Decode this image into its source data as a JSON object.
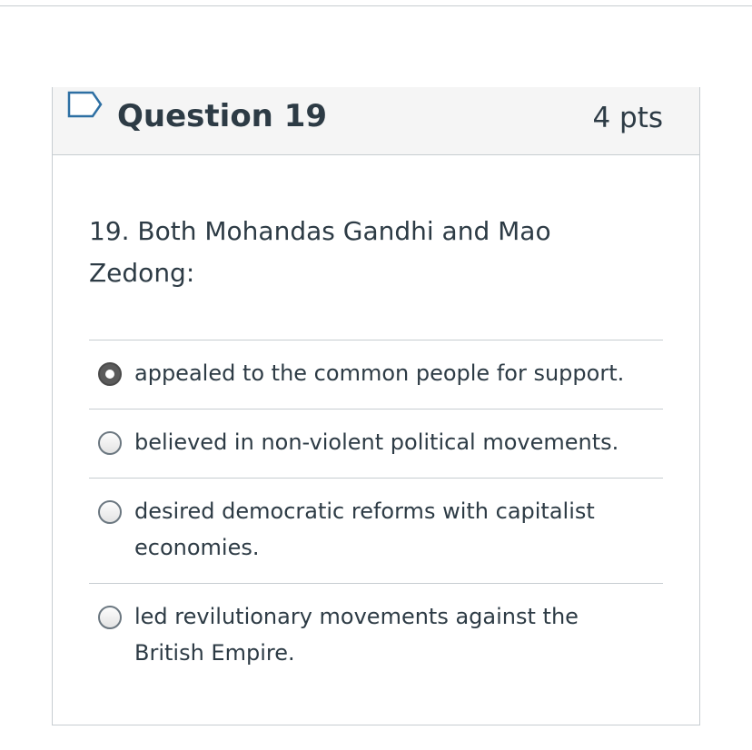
{
  "question": {
    "title": "Question 19",
    "points": "4 pts",
    "text": "19. Both Mohandas Gandhi and Mao Zedong:",
    "flag_icon": "flag-outline-icon"
  },
  "answers": [
    {
      "label": "appealed to the common people for support.",
      "selected": true
    },
    {
      "label": "believed in non-violent political movements.",
      "selected": false
    },
    {
      "label": "desired democratic reforms with capitalist economies.",
      "selected": false
    },
    {
      "label": "led revilutionary movements against the British Empire.",
      "selected": false
    }
  ],
  "colors": {
    "text": "#2d3b45",
    "border": "#c7cdd1",
    "header_bg": "#f5f5f5",
    "flag": "#2d6fa3"
  }
}
